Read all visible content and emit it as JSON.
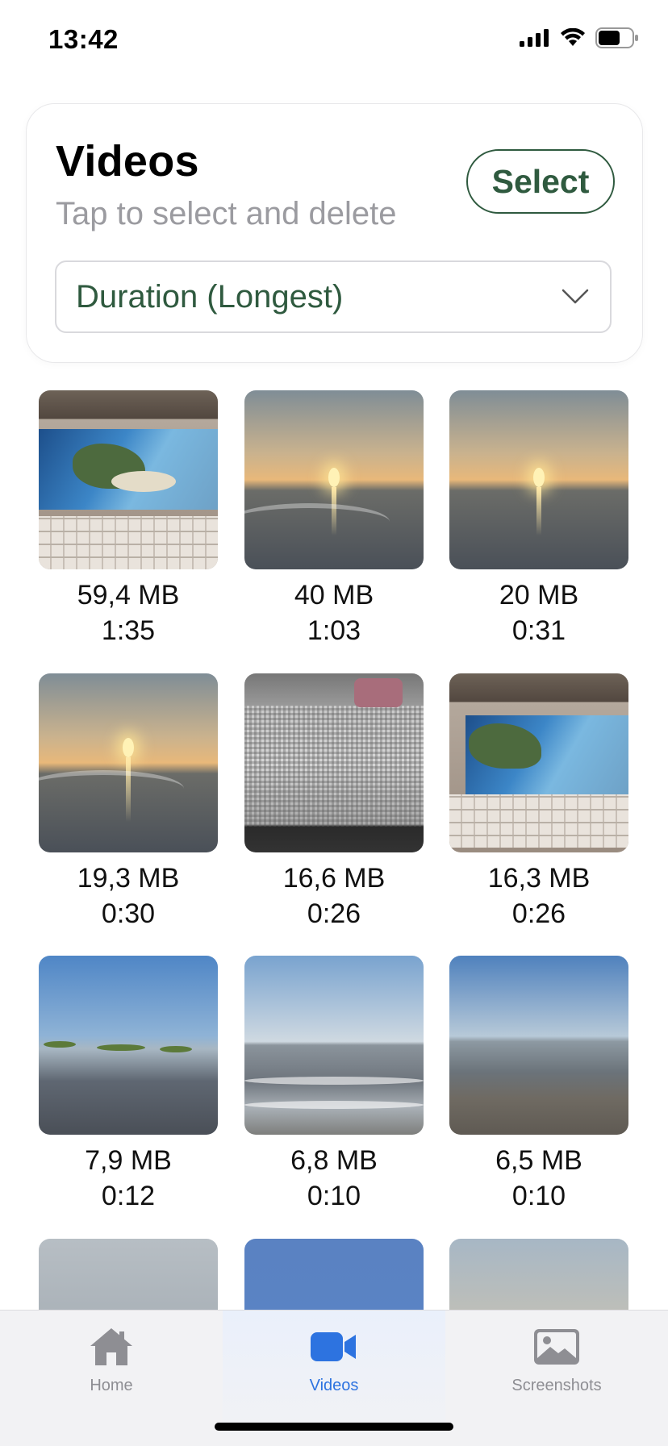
{
  "status_bar": {
    "time": "13:42"
  },
  "header": {
    "title": "Videos",
    "subtitle": "Tap to select and delete",
    "select_label": "Select",
    "sort": {
      "selected": "Duration (Longest)"
    }
  },
  "videos": [
    {
      "size": "59,4 MB",
      "duration": "1:35",
      "thumb": "laptop-screen"
    },
    {
      "size": "40 MB",
      "duration": "1:03",
      "thumb": "sunset-beach"
    },
    {
      "size": "20 MB",
      "duration": "0:31",
      "thumb": "sunset-beach"
    },
    {
      "size": "19,3 MB",
      "duration": "0:30",
      "thumb": "sunset-beach"
    },
    {
      "size": "16,6 MB",
      "duration": "0:26",
      "thumb": "screen-closeup"
    },
    {
      "size": "16,3 MB",
      "duration": "0:26",
      "thumb": "laptop-screen"
    },
    {
      "size": "7,9 MB",
      "duration": "0:12",
      "thumb": "beach-rocks"
    },
    {
      "size": "6,8 MB",
      "duration": "0:10",
      "thumb": "sea-waves"
    },
    {
      "size": "6,5 MB",
      "duration": "0:10",
      "thumb": "sea-shore"
    },
    {
      "thumb": "water-blur"
    },
    {
      "thumb": "blue-sky"
    },
    {
      "thumb": "hazy-sunset"
    }
  ],
  "tab_bar": {
    "tabs": [
      {
        "label": "Home",
        "icon": "house-icon",
        "active": false
      },
      {
        "label": "Videos",
        "icon": "video-camera-icon",
        "active": true
      },
      {
        "label": "Screenshots",
        "icon": "photo-icon",
        "active": false
      }
    ]
  },
  "colors": {
    "accent_green": "#2f5a3f",
    "active_tab_blue": "#2d73e0",
    "inactive_gray": "#8e8e93"
  }
}
